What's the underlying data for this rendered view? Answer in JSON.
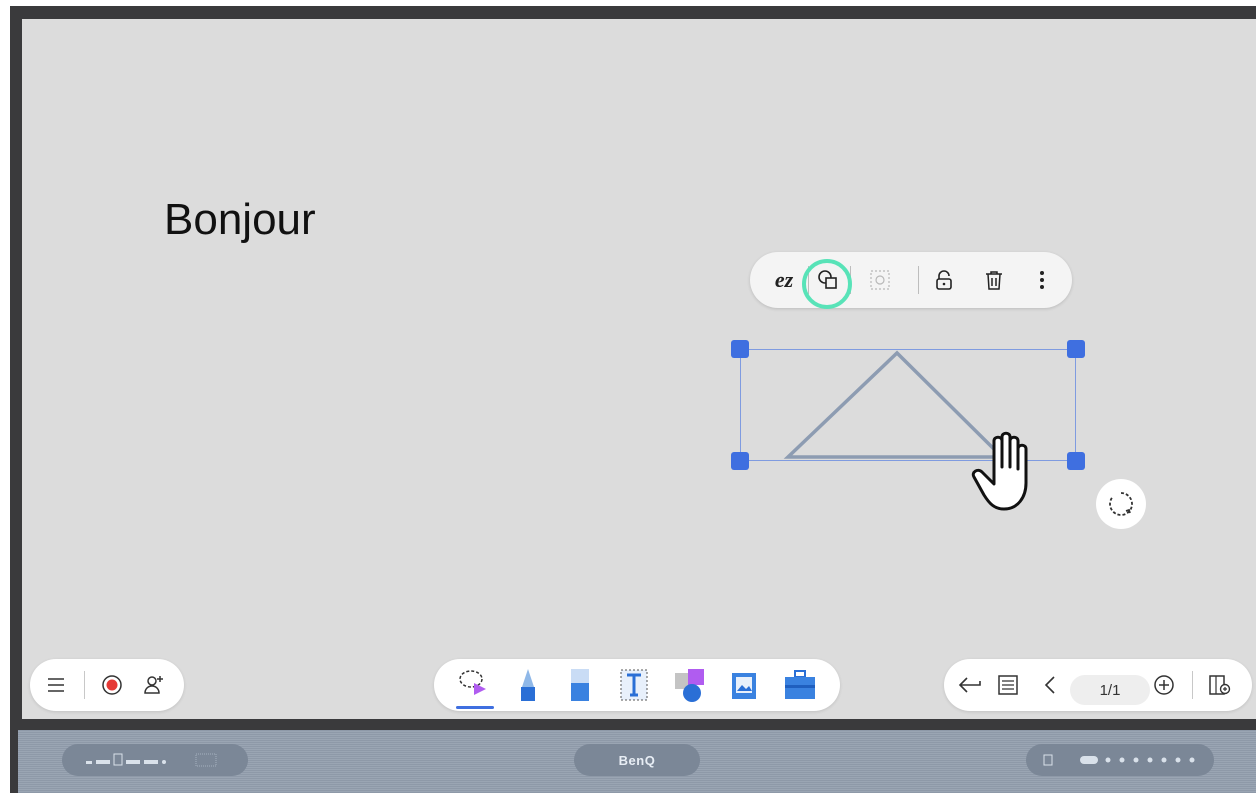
{
  "canvas": {
    "text": "Bonjour"
  },
  "object_toolbar": {
    "ez_label": "ez",
    "icons": [
      "convert-shape-icon",
      "group-icon",
      "lock-icon",
      "delete-icon",
      "more-icon"
    ]
  },
  "bottom_left": {
    "icons": [
      "menu-icon",
      "record-icon",
      "add-user-icon"
    ]
  },
  "bottom_center": {
    "tools": [
      "lasso-select-icon",
      "pen-icon",
      "eraser-icon",
      "text-box-icon",
      "shapes-icon",
      "image-icon",
      "toolbox-icon"
    ]
  },
  "bottom_right": {
    "page_indicator": "1/1",
    "icons": [
      "undo-icon",
      "page-settings-icon",
      "prev-page-icon",
      "add-page-icon",
      "page-manager-icon"
    ]
  },
  "bezel": {
    "brand": "BenQ"
  },
  "colors": {
    "highlight": "#58e3b8",
    "selection": "#3f6fe0",
    "canvas_bg": "#dcdcdc"
  }
}
